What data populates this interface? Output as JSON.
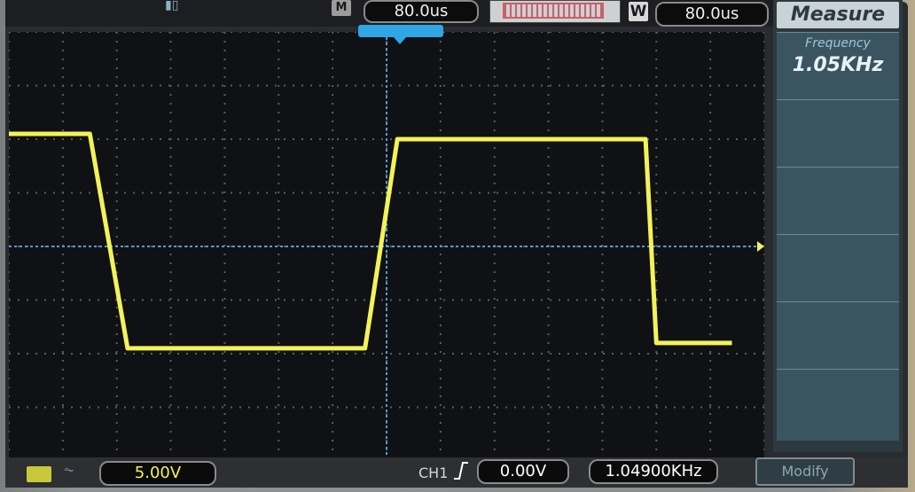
{
  "header": {
    "memory_label": "M",
    "timebase": "80.0us",
    "window_label": "W",
    "window_timebase": "80.0us"
  },
  "menu": {
    "title": "Measure",
    "items": [
      {
        "label": "Frequency",
        "value": "1.05KHz"
      },
      {
        "label": "",
        "value": ""
      },
      {
        "label": "",
        "value": ""
      },
      {
        "label": "",
        "value": ""
      },
      {
        "label": "",
        "value": ""
      },
      {
        "label": "",
        "value": ""
      }
    ]
  },
  "footer": {
    "volts_per_div": "5.00V",
    "channel": "CH1",
    "trigger_level": "0.00V",
    "frequency": "1.04900KHz",
    "modify_label": "Modify"
  },
  "colors": {
    "trace": "#f2f25a",
    "grid": "#5a5d63",
    "axis": "#4f9ed0",
    "menu_bg": "#2c3a40",
    "accent": "#2fa6e6"
  },
  "chart_data": {
    "type": "line",
    "title": "",
    "xlabel": "",
    "ylabel": "",
    "x_divisions": 14,
    "y_divisions": 8,
    "xlim": [
      -7,
      7
    ],
    "ylim": [
      -4,
      4
    ],
    "units": {
      "x": "div (80.0us/div)",
      "y": "div (5.00V/div)"
    },
    "series": [
      {
        "x": [
          -7.0,
          -5.5,
          -4.8,
          -0.4,
          0.2,
          4.8,
          5.0,
          6.4
        ],
        "y": [
          2.1,
          2.1,
          -1.9,
          -1.9,
          2.0,
          2.0,
          -1.8,
          -1.8
        ]
      }
    ]
  }
}
